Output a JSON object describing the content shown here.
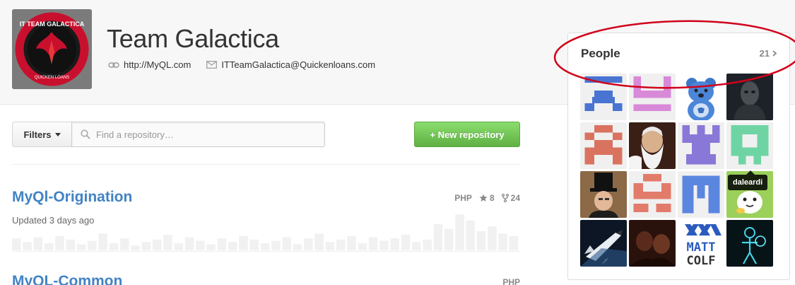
{
  "org": {
    "name": "Team Galactica",
    "website": "http://MyQL.com",
    "email": "ITTeamGalactica@Quickenloans.com",
    "avatar": {
      "logo_text_top": "IT TEAM GALACTICA",
      "logo_text_bottom": "QUICKEN LOANS"
    }
  },
  "toolbar": {
    "filters_label": "Filters",
    "search_placeholder": "Find a repository…",
    "new_repo_label": "+ New repository"
  },
  "repos": [
    {
      "name": "MyQl-Origination",
      "updated": "Updated 3 days ago",
      "language": "PHP",
      "stars": "8",
      "forks": "24"
    },
    {
      "name": "MyQL-Common",
      "language": "PHP"
    }
  ],
  "people": {
    "title": "People",
    "count": "21",
    "tooltip": "daleardi",
    "avatars": [
      "identicon-blue",
      "identicon-pink",
      "care-bear",
      "dark-figure",
      "identicon-red",
      "old-man-photo",
      "identicon-purple",
      "identicon-green",
      "top-hat-photo",
      "identicon-salmon",
      "identicon-blue-block",
      "cartoon-ghost",
      "space-shuttle",
      "dark-photo",
      "matt-colf-logo",
      "tron-figure"
    ]
  },
  "colors": {
    "link": "#4183c4",
    "new_repo_green": "#60b044",
    "highlight_red": "#d0021b"
  },
  "chart_data": {
    "type": "bar",
    "title": "",
    "values": [
      10,
      7,
      11,
      6,
      12,
      9,
      5,
      8,
      14,
      6,
      10,
      4,
      7,
      9,
      13,
      6,
      11,
      8,
      5,
      10,
      7,
      12,
      9,
      6,
      8,
      11,
      5,
      10,
      14,
      7,
      9,
      12,
      6,
      11,
      8,
      10,
      13,
      7,
      9,
      22,
      18,
      30,
      25,
      16,
      20,
      14,
      12
    ]
  }
}
